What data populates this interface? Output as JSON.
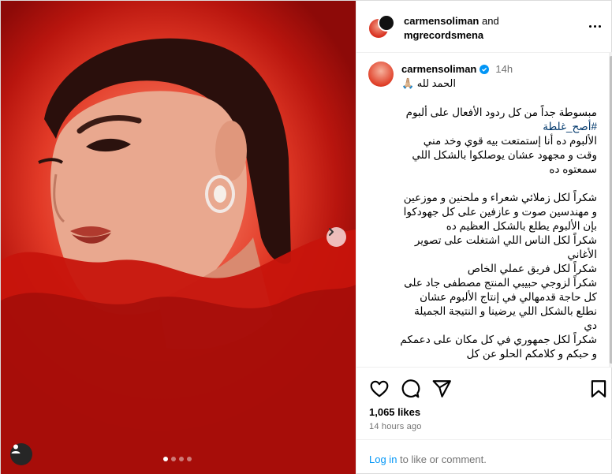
{
  "post": {
    "header": {
      "user1": "carmensoliman",
      "connector": "and",
      "user2": "mgrecordsmena"
    },
    "caption": {
      "username": "carmensoliman",
      "time": "14h",
      "first_line": "الحمد لله 🙏🏼",
      "hashtag": "#أصح_غلطة",
      "line_intro": "مبسوطة جداً من كل ردود الأفعال على ألبوم",
      "body_rest": "الألبوم ده أنا إستمتعت بيه قوي وخد مني وقت و مجهود عشان يوصلكوا بالشكل اللي سمعتوه ده\n\nشكراً لكل زملائي شعراء و ملحنين و موزعين و مهندسين صوت و عازفين على كل جهودكوا بإن الألبوم يطلع بالشكل العظيم ده\nشكراً لكل الناس اللي اشتغلت على تصوير الأغاني\nشكراً لكل فريق عملي الخاص\nشكراً لزوجي حبيبي المنتج مصطفى جاد على كل حاجة قدمهالي في إنتاج الألبوم عشان نطلع بالشكل اللي يرضينا و النتيجة الجميلة دي\nشكراً لكل جمهوري في كل مكان على دعمكم و حبكم و كلامكم الحلو عن كل"
    },
    "likes": "1,065 likes",
    "timestamp": "14 hours ago",
    "login": {
      "link": "Log in",
      "rest": " to like or comment."
    },
    "carousel": {
      "slides": 4,
      "active": 1
    }
  },
  "colors": {
    "link_blue": "#0095f6",
    "verified_blue": "#0095f6",
    "muted": "#737373",
    "hashtag": "#00376b"
  },
  "icons": [
    "heart-icon",
    "comment-icon",
    "share-icon",
    "bookmark-icon",
    "chevron-right-icon",
    "user-tag-icon",
    "more-icon",
    "verified-icon"
  ]
}
